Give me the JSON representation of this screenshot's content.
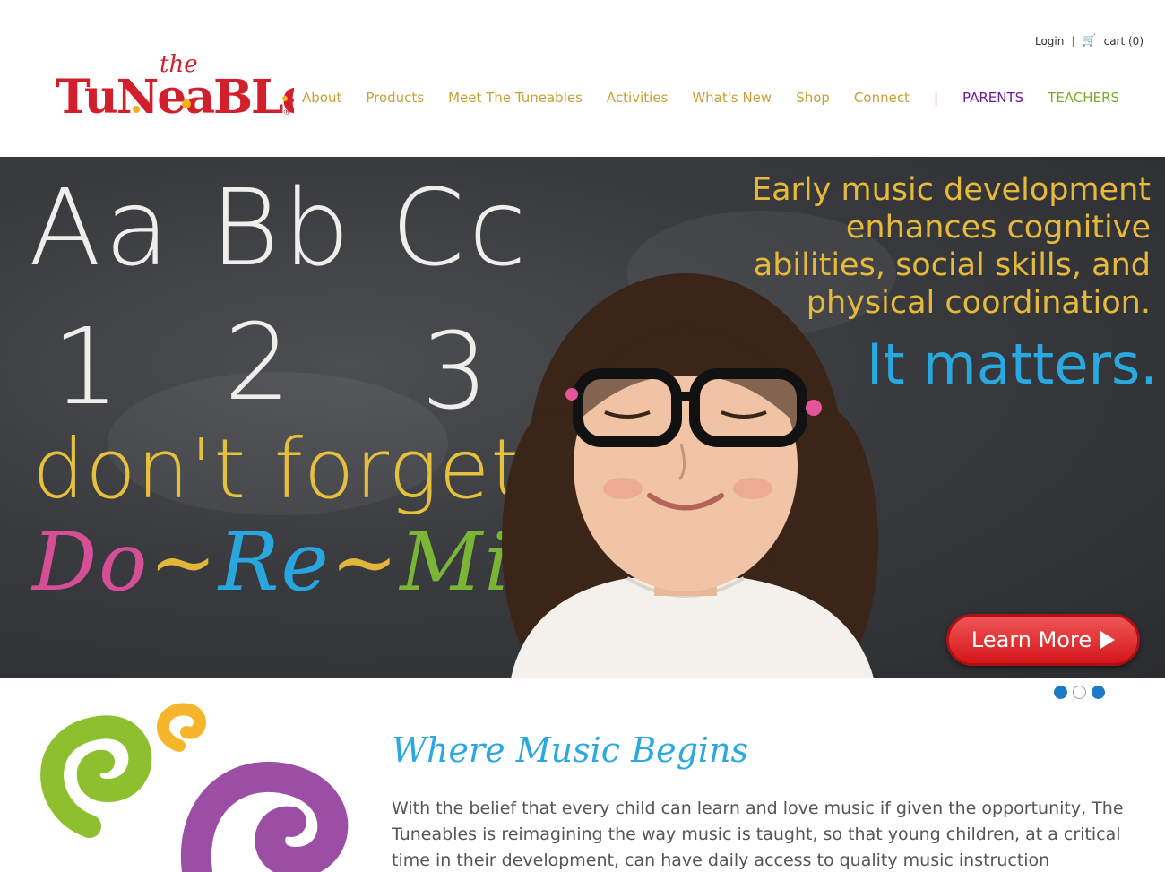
{
  "brand": {
    "logo_text": "The Tuneables"
  },
  "utility": {
    "login": "Login",
    "separator": "|",
    "cart": "cart (0)"
  },
  "nav": {
    "items": [
      "About",
      "Products",
      "Meet The Tuneables",
      "Activities",
      "What's New",
      "Shop",
      "Connect"
    ],
    "divider": "|",
    "parents": "PARENTS",
    "teachers": "TEACHERS"
  },
  "hero": {
    "chalk_letters": "Aa Bb Cc",
    "chalk_1": "1",
    "chalk_2": "2",
    "chalk_3": "3",
    "forget": "don't forget",
    "do": "Do",
    "re": "Re",
    "mi": "Mi",
    "dash": "~",
    "dot": ".",
    "headline_lines": [
      "Early music development",
      "enhances cognitive",
      "abilities, social skills, and",
      "physical coordination."
    ],
    "matters": "It matters.",
    "learn_more": "Learn More"
  },
  "carousel": {
    "active": [
      true,
      false,
      true
    ]
  },
  "welcome": {
    "title": "Where Music Begins",
    "body": "With the belief that every child can learn and love music if given the opportunity, The Tuneables is reimagining the way music is taught, so that young children, at a critical time in their development, can have daily access to quality music instruction"
  },
  "colors": {
    "gold": "#c7a136",
    "purple": "#6a1b9a",
    "green": "#7cab2c",
    "blue": "#2aa8df",
    "red": "#d3161a"
  }
}
